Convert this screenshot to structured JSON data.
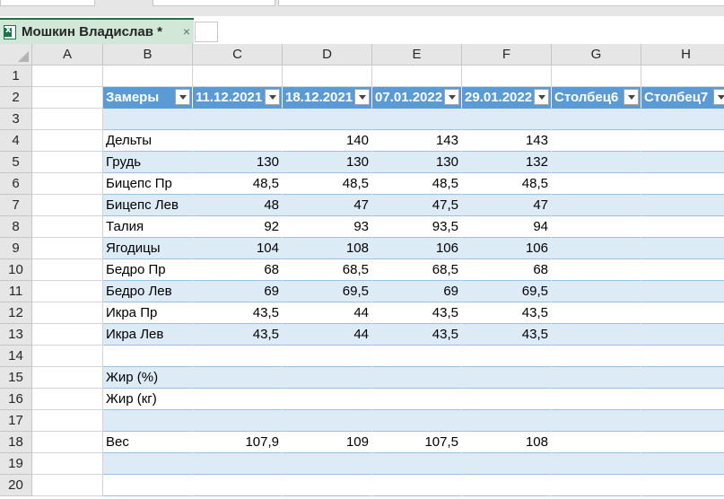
{
  "window": {
    "workbook_tab": "Мошкин Владислав *",
    "close_symbol": "×"
  },
  "columns": [
    "A",
    "B",
    "C",
    "D",
    "E",
    "F",
    "G",
    "H"
  ],
  "rows": [
    "1",
    "2",
    "3",
    "4",
    "5",
    "6",
    "7",
    "8",
    "9",
    "10",
    "11",
    "12",
    "13",
    "14",
    "15",
    "16",
    "17",
    "18",
    "19",
    "20"
  ],
  "table": {
    "headers": [
      "Замеры",
      "11.12.2021",
      "18.12.2021",
      "07.01.2022",
      "29.01.2022",
      "Столбец6",
      "Столбец7"
    ],
    "rows": [
      [
        "",
        "",
        "",
        "",
        "",
        "",
        ""
      ],
      [
        "Дельты",
        "",
        "140",
        "143",
        "143",
        "",
        ""
      ],
      [
        "Грудь",
        "130",
        "130",
        "130",
        "132",
        "",
        ""
      ],
      [
        "Бицепс Пр",
        "48,5",
        "48,5",
        "48,5",
        "48,5",
        "",
        ""
      ],
      [
        "Бицепс Лев",
        "48",
        "47",
        "47,5",
        "47",
        "",
        ""
      ],
      [
        "Талия",
        "92",
        "93",
        "93,5",
        "94",
        "",
        ""
      ],
      [
        "Ягодицы",
        "104",
        "108",
        "106",
        "106",
        "",
        ""
      ],
      [
        "Бедро Пр",
        "68",
        "68,5",
        "68,5",
        "68",
        "",
        ""
      ],
      [
        "Бедро Лев",
        "69",
        "69,5",
        "69",
        "69,5",
        "",
        ""
      ],
      [
        "Икра Пр",
        "43,5",
        "44",
        "43,5",
        "43,5",
        "",
        ""
      ],
      [
        "Икра Лев",
        "43,5",
        "44",
        "43,5",
        "43,5",
        "",
        ""
      ],
      [
        "",
        "",
        "",
        "",
        "",
        "",
        ""
      ],
      [
        "Жир (%)",
        "",
        "",
        "",
        "",
        "",
        ""
      ],
      [
        "Жир (кг)",
        "",
        "",
        "",
        "",
        "",
        ""
      ],
      [
        "",
        "",
        "",
        "",
        "",
        "",
        ""
      ],
      [
        "Вес",
        "107,9",
        "109",
        "107,5",
        "108",
        "",
        ""
      ],
      [
        "",
        "",
        "",
        "",
        "",
        "",
        ""
      ],
      [
        "",
        "",
        "",
        "",
        "",
        "",
        ""
      ]
    ]
  },
  "colors": {
    "header_fill": "#5b9bd5",
    "band_fill": "#ddebf7",
    "tab_fill": "#d1e7d8",
    "excel_green": "#217346"
  }
}
